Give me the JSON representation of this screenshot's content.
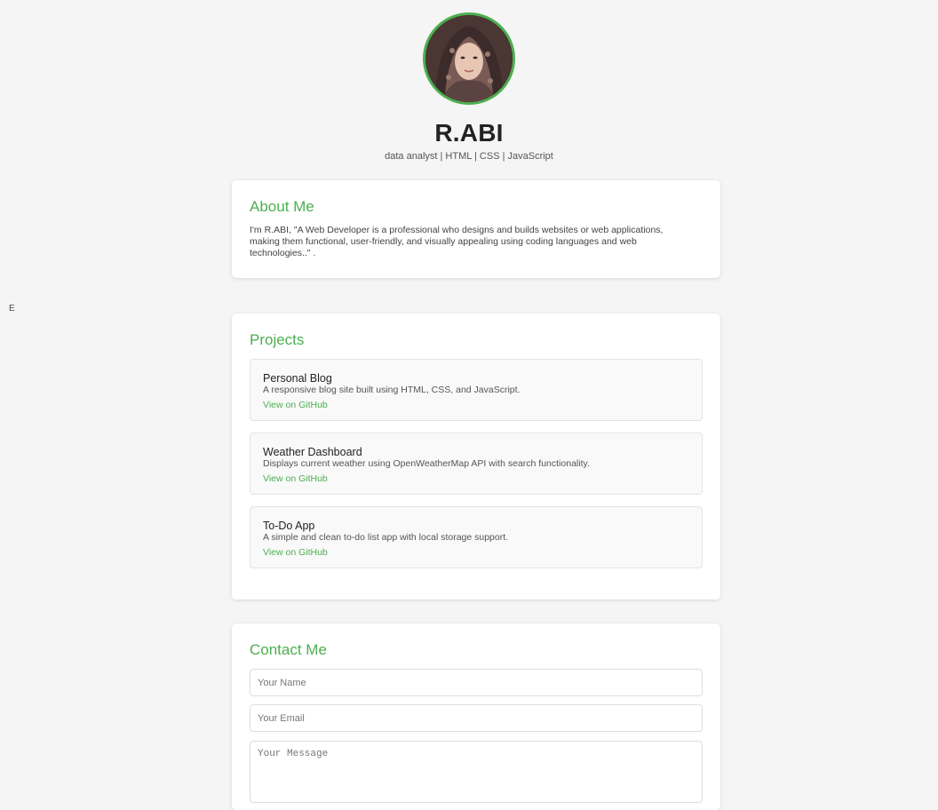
{
  "stray_char": "E",
  "header": {
    "name": "R.ABI",
    "tagline": "data analyst | HTML | CSS | JavaScript"
  },
  "about": {
    "title": "About Me",
    "text": "I'm R.ABI, \"A Web Developer is a professional who designs and builds websites or web applications, making them functional, user-friendly, and visually appealing using coding languages and web technologies..\" ."
  },
  "projects": {
    "title": "Projects",
    "items": [
      {
        "title": "Personal Blog",
        "description": "A responsive blog site built using HTML, CSS, and JavaScript.",
        "link": "View on GitHub"
      },
      {
        "title": "Weather Dashboard",
        "description": "Displays current weather using OpenWeatherMap API with search functionality.",
        "link": "View on GitHub"
      },
      {
        "title": "To-Do App",
        "description": "A simple and clean to-do list app with local storage support.",
        "link": "View on GitHub"
      }
    ]
  },
  "contact": {
    "title": "Contact Me",
    "name_placeholder": "Your Name",
    "email_placeholder": "Your Email",
    "message_placeholder": "Your Message"
  },
  "colors": {
    "accent": "#4caf50",
    "background": "#f5f5f5"
  }
}
